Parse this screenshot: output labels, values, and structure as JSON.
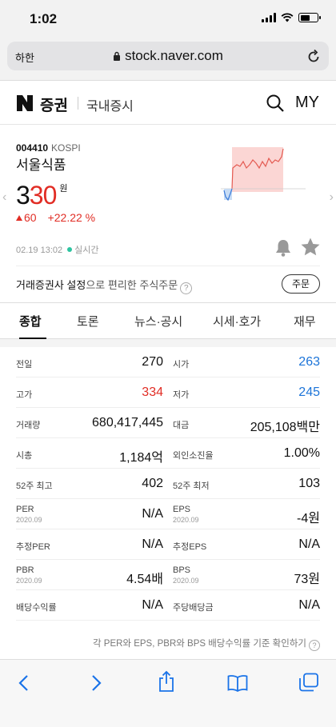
{
  "status": {
    "time": "1:02"
  },
  "browser": {
    "aa": "하한",
    "url": "stock.naver.com"
  },
  "header": {
    "brand": "증권",
    "market": "국내증시",
    "my": "MY"
  },
  "stock": {
    "code": "004410",
    "exchange": "KOSPI",
    "name": "서울식품",
    "price_part1": "3",
    "price_part2": "30",
    "unit": "원",
    "change": "60",
    "change_pct": "+22.22 %",
    "timestamp": "02.19 13:02",
    "realtime": "실시간",
    "broker_text_a": "거래증권사 설정",
    "broker_text_b": "으로 편리한 주식주문",
    "order_button": "주문"
  },
  "tabs": [
    "종합",
    "토론",
    "뉴스·공시",
    "시세·호가",
    "재무"
  ],
  "rows": [
    {
      "l_label": "전일",
      "l_sub": "",
      "l_value": "270",
      "r_label": "시가",
      "r_sub": "",
      "r_value": "263",
      "r_color": "blue"
    },
    {
      "l_label": "고가",
      "l_sub": "",
      "l_value": "334",
      "l_color": "red",
      "r_label": "저가",
      "r_sub": "",
      "r_value": "245",
      "r_color": "blue"
    },
    {
      "l_label": "거래량",
      "l_sub": "",
      "l_value": "680,417,445",
      "r_label": "대금",
      "r_sub": "",
      "r_value": "205,108백만"
    },
    {
      "l_label": "시총",
      "l_sub": "",
      "l_value": "1,184억",
      "r_label": "외인소진율",
      "r_sub": "",
      "r_value": "1.00%"
    },
    {
      "l_label": "52주 최고",
      "l_sub": "",
      "l_value": "402",
      "r_label": "52주 최저",
      "r_sub": "",
      "r_value": "103"
    },
    {
      "l_label": "PER",
      "l_sub": "2020.09",
      "l_value": "N/A",
      "r_label": "EPS",
      "r_sub": "2020.09",
      "r_value": "-4원"
    },
    {
      "l_label": "추정PER",
      "l_sub": "",
      "l_value": "N/A",
      "r_label": "추정EPS",
      "r_sub": "",
      "r_value": "N/A"
    },
    {
      "l_label": "PBR",
      "l_sub": "2020.09",
      "l_value": "4.54배",
      "r_label": "BPS",
      "r_sub": "2020.09",
      "r_value": "73원"
    },
    {
      "l_label": "배당수익률",
      "l_sub": "",
      "l_value": "N/A",
      "r_label": "주당배당금",
      "r_sub": "",
      "r_value": "N/A"
    }
  ],
  "note": "각 PER와 EPS, PBR와 BPS 배당수익률 기준 확인하기",
  "colors": {
    "up": "#e12d25",
    "down": "#1c74d8"
  }
}
